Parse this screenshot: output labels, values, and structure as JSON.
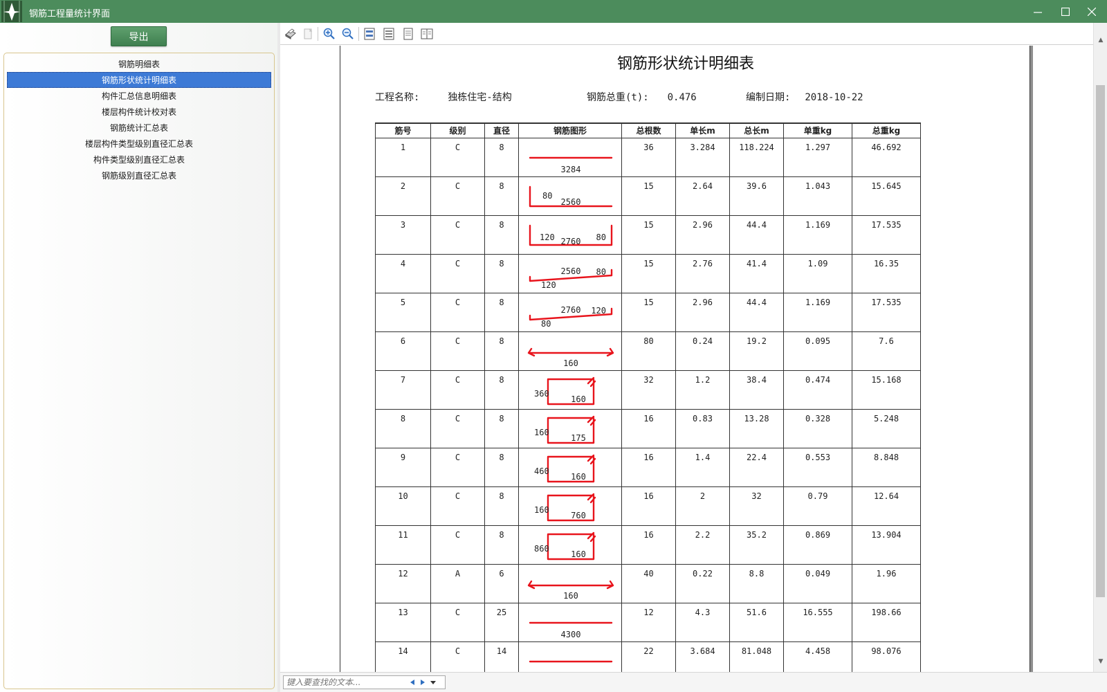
{
  "window": {
    "title": "钢筋工程量统计界面",
    "icons": {
      "app": "app-logo-icon",
      "minimize": "minimize-icon",
      "maximize": "maximize-icon",
      "close": "close-icon"
    }
  },
  "sidebar": {
    "export_label": "导出",
    "items": [
      {
        "label": "钢筋明细表",
        "selected": false
      },
      {
        "label": "钢筋形状统计明细表",
        "selected": true
      },
      {
        "label": "构件汇总信息明细表",
        "selected": false
      },
      {
        "label": "楼层构件统计校对表",
        "selected": false
      },
      {
        "label": "钢筋统计汇总表",
        "selected": false
      },
      {
        "label": "楼层构件类型级别直径汇总表",
        "selected": false
      },
      {
        "label": "构件类型级别直径汇总表",
        "selected": false
      },
      {
        "label": "钢筋级别直径汇总表",
        "selected": false
      }
    ]
  },
  "toolbar": {
    "buttons": [
      "print-icon",
      "copy-icon",
      "zoom-in-icon",
      "zoom-out-icon",
      "page-width-icon",
      "whole-page-icon",
      "single-page-icon",
      "two-page-icon"
    ]
  },
  "report": {
    "title": "钢筋形状统计明细表",
    "project_label": "工程名称:",
    "project_name": "独栋住宅-结构",
    "total_weight_label": "钢筋总重(t):",
    "total_weight": "0.476",
    "date_label": "编制日期:",
    "date": "2018-10-22",
    "shape_color": "#e8141c",
    "columns": [
      "筋号",
      "级别",
      "直径",
      "钢筋图形",
      "总根数",
      "单长m",
      "总长m",
      "单重kg",
      "总重kg"
    ],
    "rows": [
      {
        "no": "1",
        "grade": "C",
        "dia": "8",
        "shape": "straight",
        "dims": [
          "3284"
        ],
        "count": "36",
        "unit_len": "3.284",
        "total_len": "118.224",
        "unit_wt": "1.297",
        "total_wt": "46.692"
      },
      {
        "no": "2",
        "grade": "C",
        "dia": "8",
        "shape": "l-left",
        "dims": [
          "80",
          "2560"
        ],
        "count": "15",
        "unit_len": "2.64",
        "total_len": "39.6",
        "unit_wt": "1.043",
        "total_wt": "15.645"
      },
      {
        "no": "3",
        "grade": "C",
        "dia": "8",
        "shape": "u",
        "dims": [
          "120",
          "2760",
          "80"
        ],
        "count": "15",
        "unit_len": "2.96",
        "total_len": "44.4",
        "unit_wt": "1.169",
        "total_wt": "17.535"
      },
      {
        "no": "4",
        "grade": "C",
        "dia": "8",
        "shape": "z",
        "dims": [
          "2560",
          "80",
          "120"
        ],
        "count": "15",
        "unit_len": "2.76",
        "total_len": "41.4",
        "unit_wt": "1.09",
        "total_wt": "16.35"
      },
      {
        "no": "5",
        "grade": "C",
        "dia": "8",
        "shape": "z",
        "dims": [
          "2760",
          "120",
          "80"
        ],
        "count": "15",
        "unit_len": "2.96",
        "total_len": "44.4",
        "unit_wt": "1.169",
        "total_wt": "17.535"
      },
      {
        "no": "6",
        "grade": "C",
        "dia": "8",
        "shape": "tie",
        "dims": [
          "160"
        ],
        "count": "80",
        "unit_len": "0.24",
        "total_len": "19.2",
        "unit_wt": "0.095",
        "total_wt": "7.6"
      },
      {
        "no": "7",
        "grade": "C",
        "dia": "8",
        "shape": "stirrup",
        "dims": [
          "360",
          "160"
        ],
        "count": "32",
        "unit_len": "1.2",
        "total_len": "38.4",
        "unit_wt": "0.474",
        "total_wt": "15.168"
      },
      {
        "no": "8",
        "grade": "C",
        "dia": "8",
        "shape": "stirrup",
        "dims": [
          "160",
          "175"
        ],
        "count": "16",
        "unit_len": "0.83",
        "total_len": "13.28",
        "unit_wt": "0.328",
        "total_wt": "5.248"
      },
      {
        "no": "9",
        "grade": "C",
        "dia": "8",
        "shape": "stirrup",
        "dims": [
          "460",
          "160"
        ],
        "count": "16",
        "unit_len": "1.4",
        "total_len": "22.4",
        "unit_wt": "0.553",
        "total_wt": "8.848"
      },
      {
        "no": "10",
        "grade": "C",
        "dia": "8",
        "shape": "stirrup",
        "dims": [
          "160",
          "760"
        ],
        "count": "16",
        "unit_len": "2",
        "total_len": "32",
        "unit_wt": "0.79",
        "total_wt": "12.64"
      },
      {
        "no": "11",
        "grade": "C",
        "dia": "8",
        "shape": "stirrup",
        "dims": [
          "860",
          "160"
        ],
        "count": "16",
        "unit_len": "2.2",
        "total_len": "35.2",
        "unit_wt": "0.869",
        "total_wt": "13.904"
      },
      {
        "no": "12",
        "grade": "A",
        "dia": "6",
        "shape": "tie",
        "dims": [
          "160"
        ],
        "count": "40",
        "unit_len": "0.22",
        "total_len": "8.8",
        "unit_wt": "0.049",
        "total_wt": "1.96"
      },
      {
        "no": "13",
        "grade": "C",
        "dia": "25",
        "shape": "straight",
        "dims": [
          "4300"
        ],
        "count": "12",
        "unit_len": "4.3",
        "total_len": "51.6",
        "unit_wt": "16.555",
        "total_wt": "198.66"
      },
      {
        "no": "14",
        "grade": "C",
        "dia": "14",
        "shape": "straight",
        "dims": [],
        "count": "22",
        "unit_len": "3.684",
        "total_len": "81.048",
        "unit_wt": "4.458",
        "total_wt": "98.076"
      }
    ]
  },
  "search": {
    "placeholder": "键入要查找的文本..."
  }
}
